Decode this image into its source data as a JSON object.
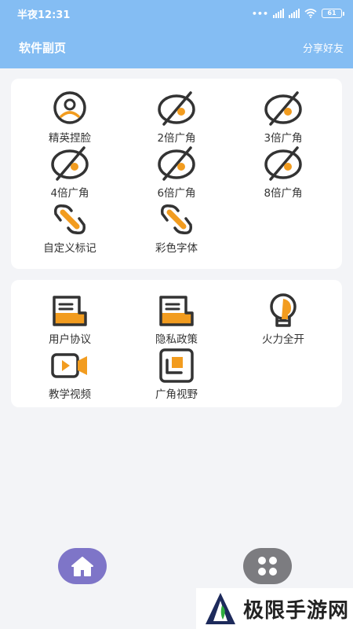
{
  "status_bar": {
    "time": "半夜12:31",
    "battery": "61"
  },
  "header": {
    "title": "软件副页",
    "share_label": "分享好友"
  },
  "section1": {
    "items": [
      {
        "label": "精英捏脸",
        "icon": "face-icon"
      },
      {
        "label": "2倍广角",
        "icon": "eye-slash-icon"
      },
      {
        "label": "3倍广角",
        "icon": "eye-slash-icon"
      },
      {
        "label": "4倍广角",
        "icon": "eye-slash-icon"
      },
      {
        "label": "6倍广角",
        "icon": "eye-slash-icon"
      },
      {
        "label": "8倍广角",
        "icon": "eye-slash-icon"
      },
      {
        "label": "自定义标记",
        "icon": "link-icon"
      },
      {
        "label": "彩色字体",
        "icon": "link-icon"
      }
    ]
  },
  "section2": {
    "items": [
      {
        "label": "用户协议",
        "icon": "document-icon"
      },
      {
        "label": "隐私政策",
        "icon": "document-icon"
      },
      {
        "label": "火力全开",
        "icon": "lightbulb-icon"
      },
      {
        "label": "教学视频",
        "icon": "video-camera-icon"
      },
      {
        "label": "广角视野",
        "icon": "crop-frame-icon"
      }
    ]
  },
  "nav": {
    "home_icon": "home-icon",
    "apps_icon": "grid-icon"
  },
  "watermark": {
    "text": "极限手游网"
  },
  "colors": {
    "header": "#84bdf3",
    "accent": "#f29c1f",
    "icon_stroke": "#333333",
    "home_button": "#7e75c8",
    "apps_button": "#7c7c80"
  }
}
